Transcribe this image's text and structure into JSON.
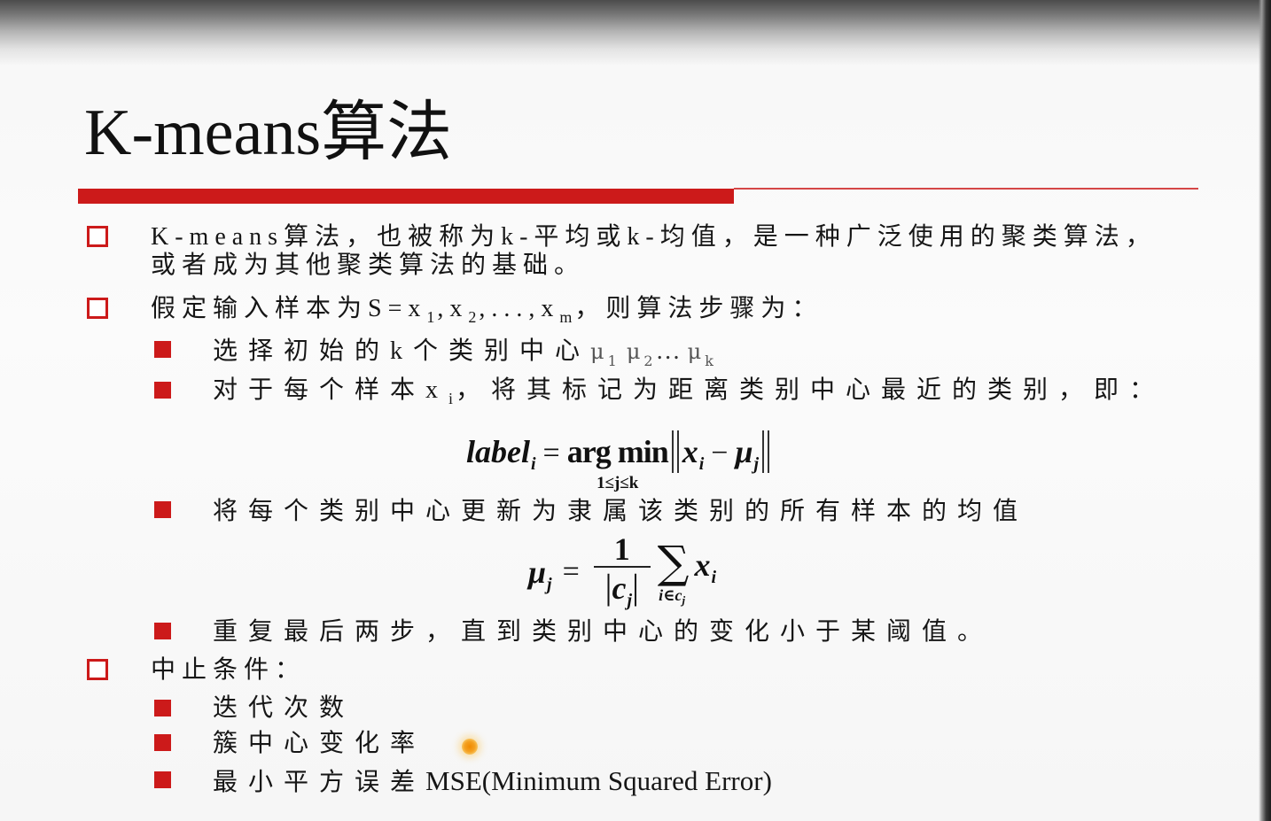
{
  "colors": {
    "accent": "#cc1a1a",
    "text": "#161616",
    "pointer": "#f5a623"
  },
  "slide": {
    "title": "K-means算法",
    "bullet_1": {
      "line_1": "K-means算法，也被称为k-平均或k-均值，是一种广泛使用的聚类算法，",
      "line_2": "或者成为其他聚类算法的基础。"
    },
    "bullet_2": {
      "text_a": "假定输入样本为S=x",
      "sub_a": "1",
      "text_b": ",x",
      "sub_b": "2",
      "text_c": ",...,x",
      "sub_c": "m",
      "text_d": "，则算法步骤为："
    },
    "step_1": {
      "text": "选择初始的k个类别中心",
      "mu_1": "μ",
      "sub_1": "1",
      "mu_2": "μ",
      "sub_2": "2",
      "ellipsis": "…",
      "mu_k": "μ",
      "sub_k": "k"
    },
    "step_2": {
      "text_a": "对于每个样本x",
      "sub": "i",
      "text_b": "，将其标记为距离类别中心最近的类别，即："
    },
    "formula_label": {
      "lhs": "label",
      "lhs_sub": "i",
      "eq": "=",
      "op": "arg min",
      "op_sub": "1≤j≤k",
      "x": "x",
      "x_sub": "i",
      "minus": "−",
      "mu": "μ",
      "mu_sub": "j"
    },
    "step_3": {
      "text": "将每个类别中心更新为隶属该类别的所有样本的均值"
    },
    "formula_mean": {
      "lhs": "μ",
      "lhs_sub": "j",
      "eq": "=",
      "num": "1",
      "den_bar_left": "|",
      "den": "c",
      "den_sub": "j",
      "den_bar_right": "|",
      "sum": "∑",
      "sum_sub": "i∈c",
      "sum_sub_sub": "j",
      "x": "x",
      "x_sub": "i"
    },
    "step_4": {
      "text": "重复最后两步，直到类别中心的变化小于某阈值。"
    },
    "bullet_3": {
      "text": "中止条件："
    },
    "stop_criteria": [
      {
        "text": "迭代次数"
      },
      {
        "text": "簇中心变化率"
      },
      {
        "text_cn": "最小平方误差",
        "text_en": "MSE(Minimum Squared Error)"
      }
    ]
  }
}
